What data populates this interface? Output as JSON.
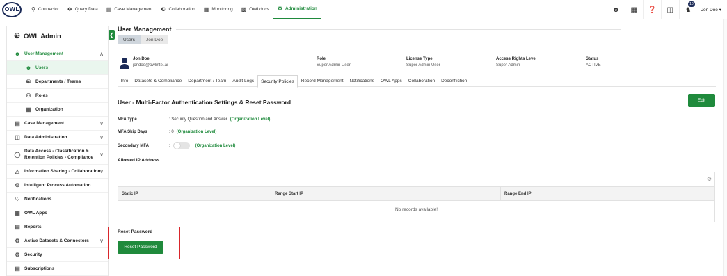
{
  "brand": {
    "logo_text": "OWL"
  },
  "nav": {
    "items": [
      {
        "label": "Connector",
        "icon": "search-icon"
      },
      {
        "label": "Query Data",
        "icon": "move-icon"
      },
      {
        "label": "Case Management",
        "icon": "case-icon"
      },
      {
        "label": "Collaboration",
        "icon": "people-icon"
      },
      {
        "label": "Monitoring",
        "icon": "monitor-icon"
      },
      {
        "label": "OWLdocs",
        "icon": "docs-icon"
      },
      {
        "label": "Administration",
        "icon": "admin-icon",
        "active": true
      }
    ]
  },
  "topright": {
    "notifications_count": "10",
    "user_name": "Jon Doe"
  },
  "sidebar": {
    "title": "OWL Admin",
    "items": [
      {
        "label": "User Management"
      },
      {
        "label": "Users"
      },
      {
        "label": "Departments / Teams"
      },
      {
        "label": "Roles"
      },
      {
        "label": "Organization"
      },
      {
        "label": "Case Management"
      },
      {
        "label": "Data Administration"
      },
      {
        "label": "Data Access - Classification & Retention Policies - Compliance"
      },
      {
        "label": "Information Sharing - Collaboration"
      },
      {
        "label": "Intelligent Process Automation"
      },
      {
        "label": "Notifications"
      },
      {
        "label": "OWL Apps"
      },
      {
        "label": "Reports"
      },
      {
        "label": "Active Datasets & Connectors"
      },
      {
        "label": "Security"
      },
      {
        "label": "Subscriptions"
      }
    ]
  },
  "main": {
    "title": "User Management",
    "breadcrumb": [
      "Users",
      "Jon Doe"
    ],
    "user": {
      "name": "Jon Doe",
      "email": "jondoe@owlintel.ai",
      "role_label": "Role",
      "role": "Super Admin User",
      "license_label": "License Type",
      "license": "Super Admin User",
      "access_label": "Access Rights Level",
      "access": "Super Admin",
      "status_label": "Status",
      "status": "ACTIVE"
    },
    "tabs": [
      "Info",
      "Datasets & Compliance",
      "Department / Team",
      "Audit Logs",
      "Security Policies",
      "Record Management",
      "Notifications",
      "OWL Apps",
      "Collaboration",
      "Deconfliction"
    ],
    "active_tab": "Security Policies",
    "section_title": "User - Multi-Factor Authentication Settings & Reset Password",
    "edit_label": "Edit",
    "mfa": {
      "type_label": "MFA Type",
      "type_value": ": Security Question and Answer",
      "type_note": "(Organization Level)",
      "skip_label": "MFA Skip Days",
      "skip_value": ": 0",
      "skip_note": "(Organization Level)",
      "secondary_label": "Secondary MFA",
      "secondary_colon": ":",
      "secondary_note": "(Organization Level)",
      "secondary_enabled": false
    },
    "ip": {
      "title": "Allowed IP Address",
      "columns": [
        "Static IP",
        "Range Start IP",
        "Range End IP"
      ],
      "empty_text": "No records available!"
    },
    "reset": {
      "title": "Reset Password",
      "button": "Reset Password"
    }
  },
  "colors": {
    "accent": "#1f8a3c",
    "brand": "#1b2a57",
    "highlight": "#d9262b"
  }
}
